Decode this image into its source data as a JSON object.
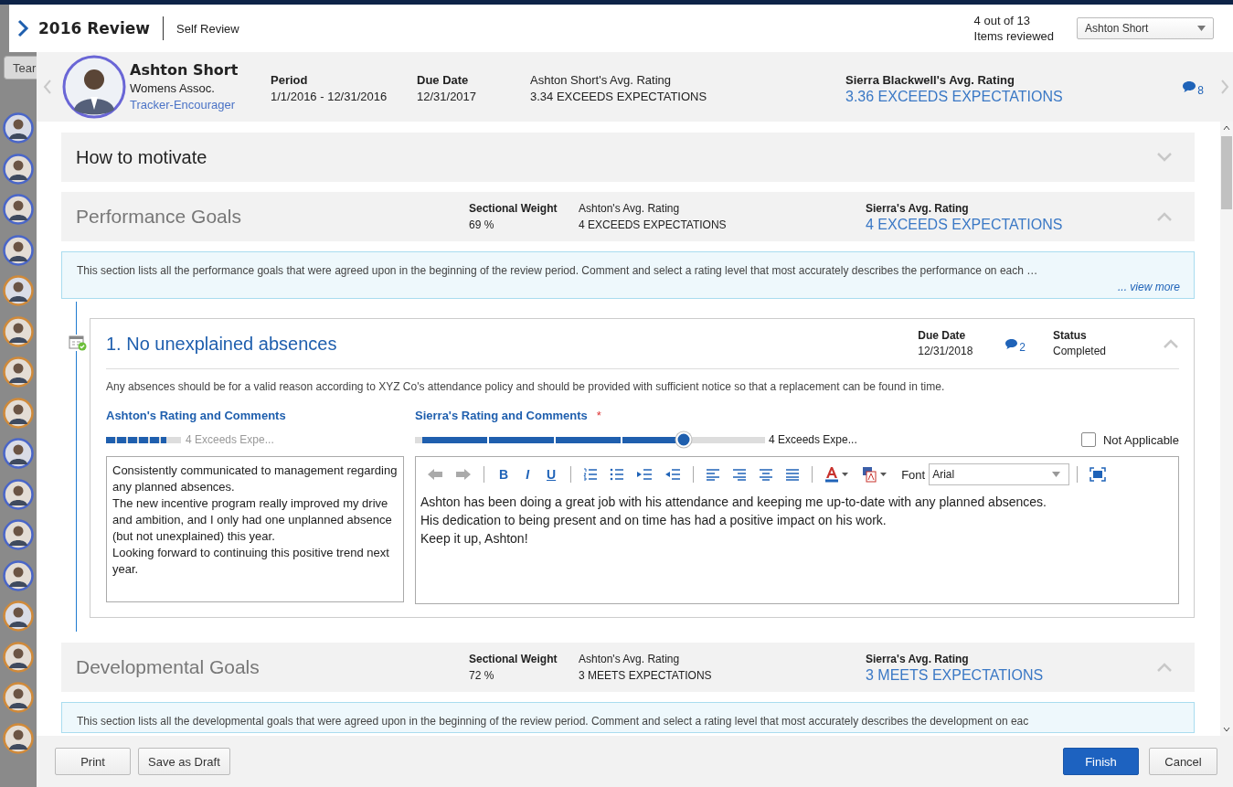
{
  "top_bar": {
    "title": "2016 Review",
    "subtitle": "Self Review",
    "progress_count": "4 out of 13",
    "progress_label": "Items reviewed",
    "reviewee_select": "Ashton Short"
  },
  "background": {
    "tab_label": "Tear"
  },
  "employee": {
    "name": "Ashton Short",
    "department": "Womens Assoc.",
    "role": "Tracker-Encourager"
  },
  "summary": [
    {
      "kind": "bold",
      "label": "Period",
      "value": "1/1/2016 - 12/31/2016"
    },
    {
      "kind": "bold",
      "label": "Due Date",
      "value": "12/31/2017"
    },
    {
      "kind": "normal",
      "label": "Ashton Short's Avg. Rating",
      "value": "3.34 EXCEEDS EXPECTATIONS"
    },
    {
      "kind": "highlight",
      "label": "Sierra Blackwell's Avg. Rating",
      "value": "3.36 EXCEEDS EXPECTATIONS"
    }
  ],
  "comments_count": "8",
  "sections": [
    {
      "title": "How to motivate",
      "expanded": false
    },
    {
      "title": "Performance Goals",
      "expanded": true,
      "weight_label": "Sectional Weight",
      "weight": "69 %",
      "self_label": "Ashton's Avg. Rating",
      "self_rating": "4 EXCEEDS EXPECTATIONS",
      "manager_label": "Sierra's Avg. Rating",
      "manager_rating": "4 EXCEEDS EXPECTATIONS",
      "info": "This section lists all the performance goals that were agreed upon in the beginning of the review period. Comment and select a rating level that most accurately describes the performance on each …",
      "view_more": "... view more",
      "goals": [
        {
          "title": "1. No unexplained absences",
          "due_label": "Due Date",
          "due": "12/31/2018",
          "comments": "2",
          "status_label": "Status",
          "status": "Completed",
          "expanded": true,
          "description": "Any absences should be for a valid reason according to XYZ Co's attendance policy and should be provided with sufficient notice so that a replacement can be found in time.",
          "self": {
            "heading": "Ashton's Rating and Comments",
            "level": 0.8,
            "rating": "4 Exceeds Expe...",
            "comment": [
              "Consistently communicated to management regarding any planned absences.",
              "The new incentive program really improved my drive and ambition, and I only had one unplanned absence (but not unexplained) this year.",
              "Looking forward to continuing this positive trend next year."
            ]
          },
          "manager": {
            "heading": "Sierra's Rating and Comments",
            "required": "*",
            "level": 0.78,
            "rating": "4 Exceeds Expe...",
            "not_applicable": {
              "label": "Not Applicable",
              "checked": false
            },
            "editor": {
              "format_buttons": [
                "B",
                "I",
                "U"
              ],
              "font_label": "Font",
              "font": "Arial",
              "text": [
                "Ashton has been doing a great job with his attendance and keeping me up-to-date with any planned absences.",
                "His dedication to being present and on time has had a positive impact on his work.",
                "Keep it up, Ashton!"
              ]
            }
          }
        }
      ]
    },
    {
      "title": "Developmental Goals",
      "expanded": true,
      "weight_label": "Sectional Weight",
      "weight": "72 %",
      "self_label": "Ashton's Avg. Rating",
      "self_rating": "3 MEETS EXPECTATIONS",
      "manager_label": "Sierra's Avg. Rating",
      "manager_rating": "3 MEETS EXPECTATIONS",
      "info": "This section lists all the developmental goals that were agreed upon in the beginning of the review period. Comment and select a rating level that most accurately describes the development on eac"
    }
  ],
  "footer": {
    "left": [
      "Print",
      "Save as Draft"
    ],
    "primary": "Finish",
    "cancel": "Cancel"
  }
}
